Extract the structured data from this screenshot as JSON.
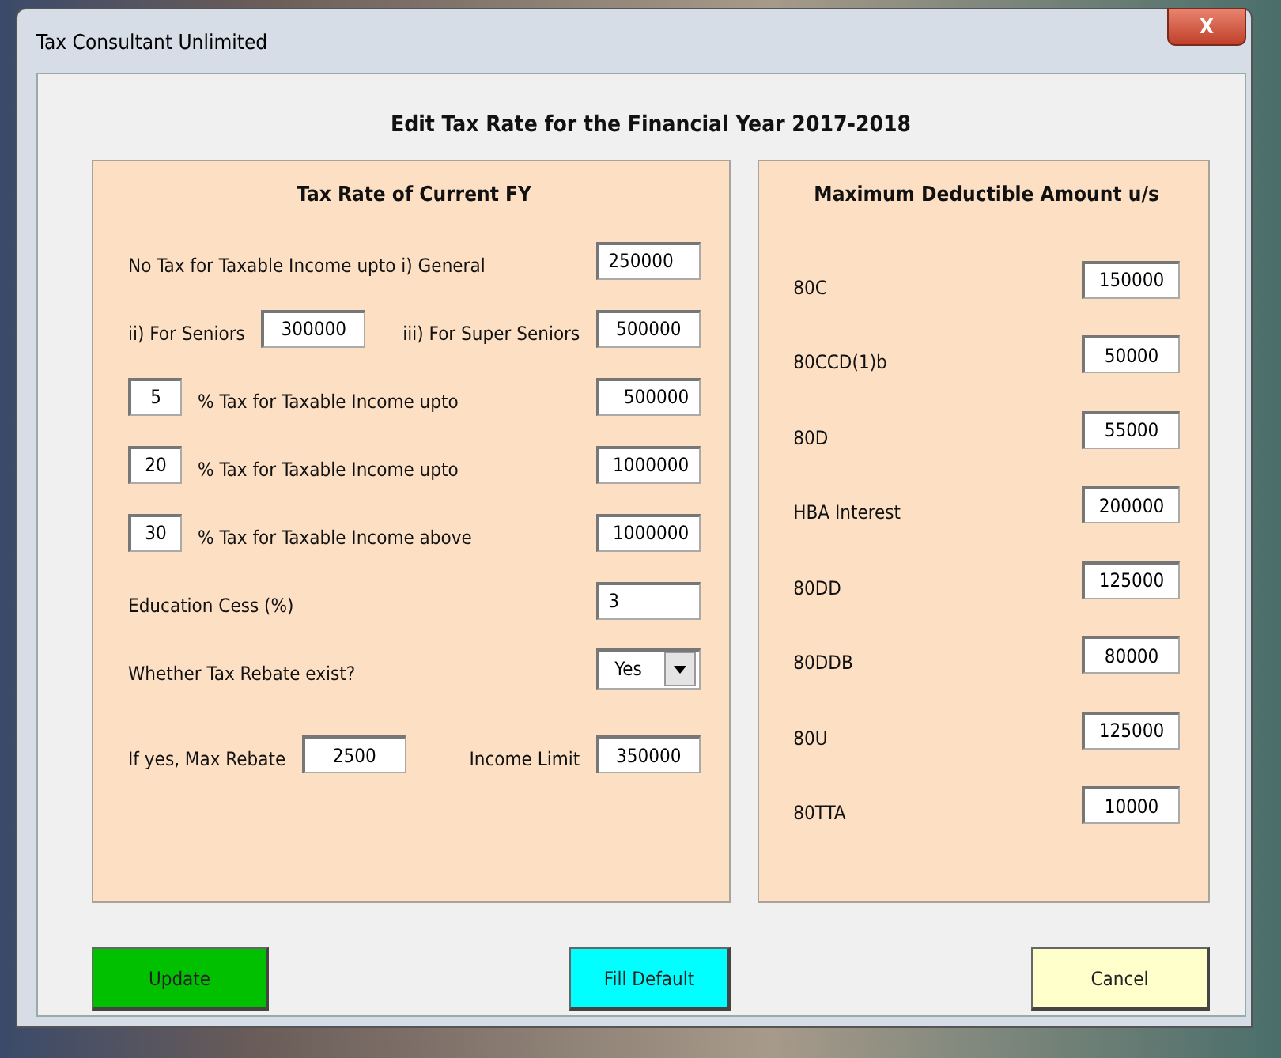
{
  "window": {
    "title": "Tax Consultant Unlimited",
    "close_label": "X"
  },
  "heading": "Edit Tax Rate for the Financial Year 2017-2018",
  "left_panel": {
    "title": "Tax Rate of Current FY",
    "rows": [
      {
        "kind": "field",
        "label": "No Tax for Taxable Income upto i) General",
        "value": "250000"
      },
      {
        "kind": "pair",
        "label": "ii) For Seniors",
        "value": "300000",
        "label_2": "iii) For Super Seniors",
        "value_2": "500000"
      },
      {
        "kind": "rate",
        "rate": "5",
        "label": "% Tax for Taxable Income upto",
        "value": "500000"
      },
      {
        "kind": "rate",
        "rate": "20",
        "label": "% Tax for Taxable Income upto",
        "value": "1000000"
      },
      {
        "kind": "rate",
        "rate": "30",
        "label": "% Tax for Taxable Income above",
        "value": "1000000"
      },
      {
        "kind": "field",
        "label": "Education Cess (%)",
        "value": "3"
      },
      {
        "kind": "select",
        "label": "Whether Tax Rebate exist?",
        "value": "Yes"
      },
      {
        "kind": "pair",
        "label": "If yes, Max Rebate",
        "value": "2500",
        "label_2": "Income Limit",
        "value_2": "350000"
      }
    ]
  },
  "right_panel": {
    "title": "Maximum Deductible Amount u/s",
    "items": [
      {
        "label": "80C",
        "value": "150000"
      },
      {
        "label": "80CCD(1)b",
        "value": "50000"
      },
      {
        "label": "80D",
        "value": "55000"
      },
      {
        "label": "HBA Interest",
        "value": "200000"
      },
      {
        "label": "80DD",
        "value": "125000"
      },
      {
        "label": "80DDB",
        "value": "80000"
      },
      {
        "label": "80U",
        "value": "125000"
      },
      {
        "label": "80TTA",
        "value": "10000"
      }
    ]
  },
  "buttons": [
    {
      "label": "Update",
      "color": "#00c000"
    },
    {
      "label": "Fill Default",
      "color": "#00ffff"
    },
    {
      "label": "Cancel",
      "color": "#ffffcc"
    }
  ]
}
